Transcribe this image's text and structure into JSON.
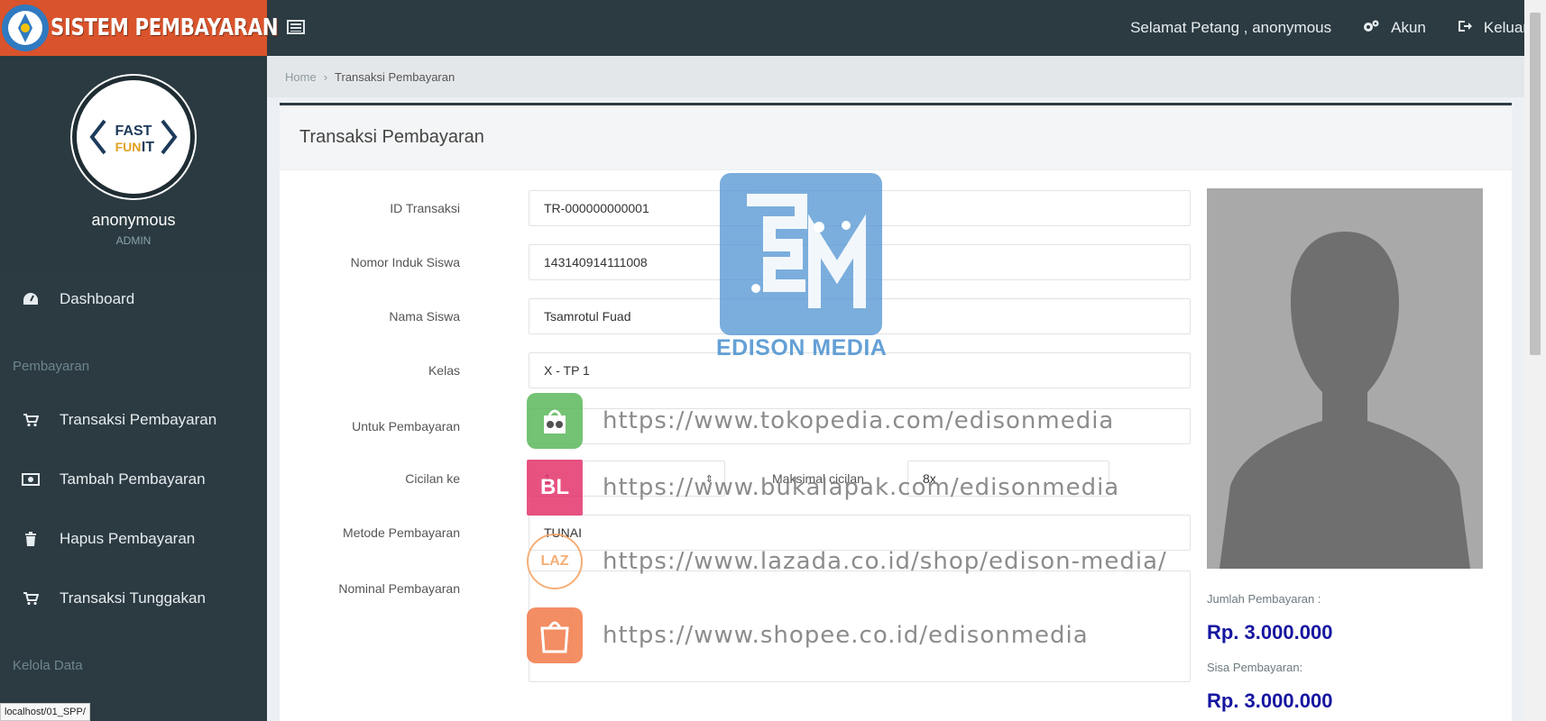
{
  "app": {
    "title": "SISTEM PEMBAYARAN"
  },
  "topnav": {
    "greeting": "Selamat Petang , anonymous",
    "account_label": "Akun",
    "logout_label": "Keluar"
  },
  "sidebar": {
    "user": {
      "name": "anonymous",
      "role": "ADMIN",
      "logo_text": "FAST IT"
    },
    "items": [
      {
        "label": "Dashboard",
        "icon": "dashboard-icon"
      },
      {
        "header": "Pembayaran"
      },
      {
        "label": "Transaksi Pembayaran",
        "icon": "cart-icon"
      },
      {
        "label": "Tambah Pembayaran",
        "icon": "money-icon"
      },
      {
        "label": "Hapus Pembayaran",
        "icon": "trash-icon"
      },
      {
        "label": "Transaksi Tunggakan",
        "icon": "cart-icon"
      },
      {
        "header": "Kelola Data"
      }
    ]
  },
  "breadcrumb": {
    "home": "Home",
    "current": "Transaksi Pembayaran"
  },
  "form": {
    "title": "Transaksi Pembayaran",
    "fields": {
      "id_transaksi": {
        "label": "ID Transaksi",
        "value": "TR-000000000001"
      },
      "nis": {
        "label": "Nomor Induk Siswa",
        "value": "143140914111008"
      },
      "nama": {
        "label": "Nama Siswa",
        "value": "Tsamrotul Fuad"
      },
      "kelas": {
        "label": "Kelas",
        "value": "X - TP 1"
      },
      "untuk": {
        "label": "Untuk Pembayaran",
        "value": ""
      },
      "cicilan": {
        "label": "Cicilan ke",
        "value": "1"
      },
      "maksimal": {
        "label": "Maksimal cicilan",
        "value": "8x"
      },
      "metode": {
        "label": "Metode Pembayaran",
        "value": "TUNAI"
      },
      "nominal": {
        "label": "Nominal Pembayaran",
        "value": ""
      }
    }
  },
  "summary": {
    "jumlah_label": "Jumlah Pembayaran :",
    "jumlah_value": "Rp. 3.000.000",
    "sisa_label": "Sisa Pembayaran:",
    "sisa_value": "Rp. 3.000.000"
  },
  "watermark": {
    "brand": "EDISON MEDIA",
    "shops": [
      {
        "icon_text": "",
        "url": "https://www.tokopedia.com/edisonmedia",
        "color": "#5cb85c"
      },
      {
        "icon_text": "BL",
        "url": "https://www.bukalapak.com/edisonmedia",
        "color": "#e4346c"
      },
      {
        "icon_text": "LAZ",
        "url": "https://www.lazada.co.id/shop/edison-media/",
        "color": "#f5a060"
      },
      {
        "icon_text": "",
        "url": "https://www.shopee.co.id/edisonmedia",
        "color": "#ee4d2d"
      }
    ]
  },
  "statusbar": {
    "text": "localhost/01_SPP/"
  },
  "colors": {
    "brand": "#d9532c",
    "nav": "#2c3b41",
    "money": "#1515a0"
  }
}
